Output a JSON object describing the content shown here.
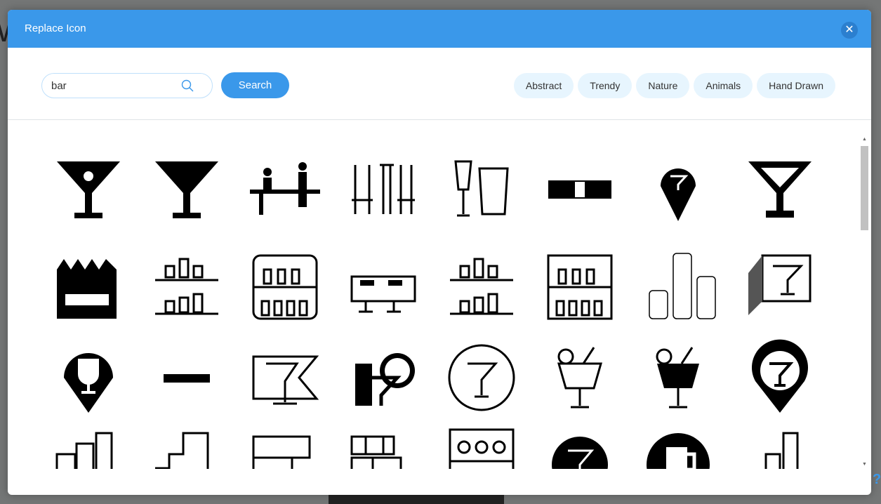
{
  "dialog": {
    "title": "Replace Icon",
    "close_icon": "close-icon"
  },
  "search": {
    "value": "bar",
    "button_label": "Search",
    "icon": "search-icon"
  },
  "categories": [
    "Abstract",
    "Trendy",
    "Nature",
    "Animals",
    "Hand Drawn"
  ],
  "colors": {
    "accent": "#3a98ea",
    "chip_bg": "#e7f5fe"
  },
  "icons": [
    "martini-glass-dot",
    "martini-glass-solid",
    "bartender-people",
    "bar-stools-table",
    "wine-beer-glasses",
    "bar-ribbon",
    "martini-map-pin",
    "martini-glass",
    "bottles-crate",
    "bottle-shelves",
    "bottle-cabinet",
    "bar-counter",
    "bottle-shelves-hand-drawn",
    "bottle-cabinet-hand-drawn",
    "bar-chart-rounded",
    "martini-sign",
    "wine-map-pin",
    "minus-bar",
    "martini-flag",
    "bottle-martini-clock",
    "martini-circle",
    "cocktail-outline",
    "cocktail-solid",
    "martini-pin-circle",
    "buildings",
    "bar-chart-steps",
    "sign-boards",
    "shelves",
    "bar-shelf",
    "martini-circle-solid",
    "beer-circle",
    "bar-chart-outline"
  ]
}
